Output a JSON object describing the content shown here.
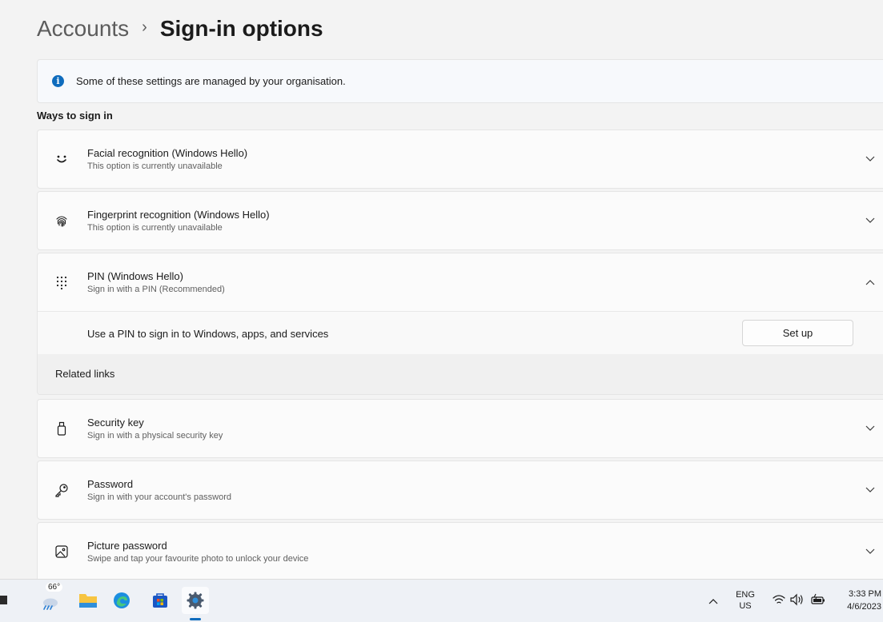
{
  "breadcrumb": {
    "parent": "Accounts",
    "separator": "›",
    "current": "Sign-in options"
  },
  "notice": {
    "text": "Some of these settings are managed by your organisation."
  },
  "section_title": "Ways to sign in",
  "options": [
    {
      "title": "Facial recognition (Windows Hello)",
      "subtitle": "This option is currently unavailable",
      "icon": "face-icon",
      "expanded": false
    },
    {
      "title": "Fingerprint recognition (Windows Hello)",
      "subtitle": "This option is currently unavailable",
      "icon": "fingerprint-icon",
      "expanded": false
    },
    {
      "title": "PIN (Windows Hello)",
      "subtitle": "Sign in with a PIN (Recommended)",
      "icon": "pin-keypad-icon",
      "expanded": true
    },
    {
      "title": "Security key",
      "subtitle": "Sign in with a physical security key",
      "icon": "usb-key-icon",
      "expanded": false
    },
    {
      "title": "Password",
      "subtitle": "Sign in with your account's password",
      "icon": "key-icon",
      "expanded": false
    },
    {
      "title": "Picture password",
      "subtitle": "Swipe and tap your favourite photo to unlock your device",
      "icon": "picture-icon",
      "expanded": false
    }
  ],
  "pin_panel": {
    "description": "Use a PIN to sign in to Windows, apps, and services",
    "setup_label": "Set up",
    "related_links_label": "Related links"
  },
  "taskbar": {
    "weather_temp": "66°",
    "icons": [
      "widgets-weather-icon",
      "file-explorer-icon",
      "edge-icon",
      "store-icon",
      "settings-icon"
    ],
    "active_app": "settings-icon",
    "language_line1": "ENG",
    "language_line2": "US",
    "time": "3:33 PM",
    "date": "4/6/2023"
  },
  "colors": {
    "accent": "#0f6cbd",
    "background": "#f3f3f3",
    "card": "#fbfbfb"
  }
}
